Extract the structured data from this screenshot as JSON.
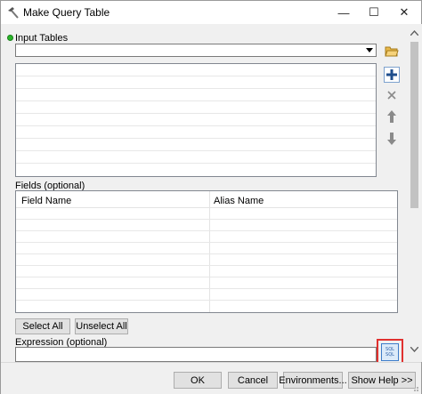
{
  "window": {
    "title": "Make Query Table",
    "minimize_glyph": "—",
    "maximize_glyph": "☐",
    "close_glyph": "✕"
  },
  "input_tables": {
    "label": "Input Tables",
    "value": ""
  },
  "side_buttons": {
    "browse_icon": "folder-open-icon",
    "add_icon": "plus-icon",
    "remove_icon": "x-icon",
    "up_icon": "arrow-up-icon",
    "down_icon": "arrow-down-icon"
  },
  "fields": {
    "label": "Fields (optional)",
    "columns": [
      "Field Name",
      "Alias Name"
    ]
  },
  "buttons": {
    "select_all": "Select All",
    "unselect_all": "Unselect All"
  },
  "expression": {
    "label": "Expression (optional)",
    "value": "",
    "sql_button_line1": "SQL",
    "sql_button_line2": "SQL"
  },
  "footer": {
    "ok": "OK",
    "cancel": "Cancel",
    "environments": "Environments...",
    "show_help": "Show Help >>"
  },
  "colors": {
    "highlight": "#e0312f",
    "required_dot": "#2ab52a",
    "add_icon": "#1f4e8c"
  }
}
